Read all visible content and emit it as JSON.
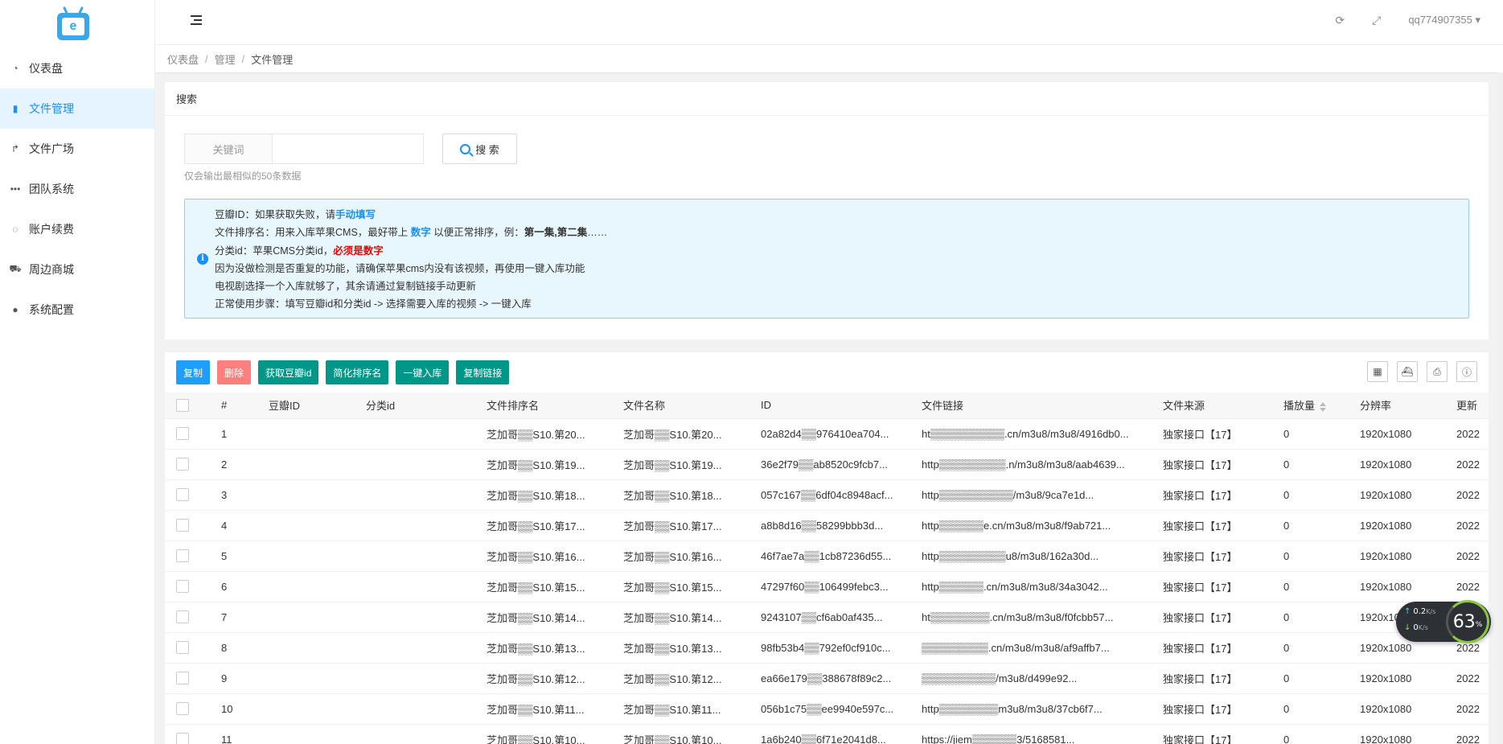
{
  "sidebar": {
    "logo_letter": "e",
    "items": [
      {
        "label": "仪表盘",
        "icon": "dashboard-icon",
        "glyph": "◔",
        "active": false
      },
      {
        "label": "文件管理",
        "icon": "file-icon",
        "glyph": "▮",
        "active": true
      },
      {
        "label": "文件广场",
        "icon": "share-icon",
        "glyph": "↱",
        "active": false
      },
      {
        "label": "团队系统",
        "icon": "more-icon",
        "glyph": "•••",
        "active": false
      },
      {
        "label": "账户续费",
        "icon": "circle-notch-icon",
        "glyph": "◌",
        "active": false
      },
      {
        "label": "周边商城",
        "icon": "cart-icon",
        "glyph": "⛟",
        "active": false
      },
      {
        "label": "系统配置",
        "icon": "user-icon",
        "glyph": "●",
        "active": false
      }
    ]
  },
  "header": {
    "username": "qq774907355",
    "caret": "▾",
    "refresh_glyph": "⟳",
    "fullscreen_glyph": "⤢"
  },
  "breadcrumb": {
    "items": [
      "仪表盘",
      "管理",
      "文件管理"
    ],
    "sep": "/"
  },
  "search": {
    "title": "搜索",
    "keyword_label": "关键词",
    "keyword_value": "",
    "button_label": "搜 索",
    "hint": "仅会输出最相似的50条数据"
  },
  "info": {
    "l1a": "豆瓣ID：如果获取失败，请",
    "l1b": "手动填写",
    "l2a": "文件排序名：用来入库苹果CMS，最好带上",
    "l2b": "数字",
    "l2c": "以便正常排序，例：",
    "l2d": "第一集,第二集",
    "l2e": "……",
    "l3a": "分类id：苹果CMS分类id，",
    "l3b": "必须是数字",
    "l4": "因为没做检测是否重复的功能，请确保苹果cms内没有该视频，再使用一键入库功能",
    "l5": "电视剧选择一个入库就够了，其余请通过复制链接手动更新",
    "l6": "正常使用步骤：填写豆瓣id和分类id -> 选择需要入库的视频 -> 一键入库"
  },
  "toolbar": {
    "copy": "复制",
    "delete": "删除",
    "fetch_douban": "获取豆瓣id",
    "simplify_sort": "简化排序名",
    "one_click_import": "一键入库",
    "copy_link": "复制链接"
  },
  "table": {
    "headers": [
      "#",
      "豆瓣ID",
      "分类id",
      "文件排序名",
      "文件名称",
      "ID",
      "文件链接",
      "文件来源",
      "播放量",
      "分辨率",
      "更新"
    ],
    "rows": [
      {
        "n": "1",
        "sort_name": "芝加哥▒▒S10.第20...",
        "file_name": "芝加哥▒▒S10.第20...",
        "id": "02a82d4▒▒976410ea704...",
        "link": "ht▒▒▒▒▒▒▒▒▒▒.cn/m3u8/m3u8/4916db0...",
        "source": "独家接口【17】",
        "plays": "0",
        "res": "1920x1080",
        "date": "2022"
      },
      {
        "n": "2",
        "sort_name": "芝加哥▒▒S10.第19...",
        "file_name": "芝加哥▒▒S10.第19...",
        "id": "36e2f79▒▒ab8520c9fcb7...",
        "link": "http▒▒▒▒▒▒▒▒▒.n/m3u8/m3u8/aab4639...",
        "source": "独家接口【17】",
        "plays": "0",
        "res": "1920x1080",
        "date": "2022"
      },
      {
        "n": "3",
        "sort_name": "芝加哥▒▒S10.第18...",
        "file_name": "芝加哥▒▒S10.第18...",
        "id": "057c167▒▒6df04c8948acf...",
        "link": "http▒▒▒▒▒▒▒▒▒▒/m3u8/9ca7e1d...",
        "source": "独家接口【17】",
        "plays": "0",
        "res": "1920x1080",
        "date": "2022"
      },
      {
        "n": "4",
        "sort_name": "芝加哥▒▒S10.第17...",
        "file_name": "芝加哥▒▒S10.第17...",
        "id": "a8b8d16▒▒58299bbb3d...",
        "link": "http▒▒▒▒▒▒e.cn/m3u8/m3u8/f9ab721...",
        "source": "独家接口【17】",
        "plays": "0",
        "res": "1920x1080",
        "date": "2022"
      },
      {
        "n": "5",
        "sort_name": "芝加哥▒▒S10.第16...",
        "file_name": "芝加哥▒▒S10.第16...",
        "id": "46f7ae7a▒▒1cb87236d55...",
        "link": "http▒▒▒▒▒▒▒▒▒u8/m3u8/162a30d...",
        "source": "独家接口【17】",
        "plays": "0",
        "res": "1920x1080",
        "date": "2022"
      },
      {
        "n": "6",
        "sort_name": "芝加哥▒▒S10.第15...",
        "file_name": "芝加哥▒▒S10.第15...",
        "id": "47297f60▒▒106499febc3...",
        "link": "http▒▒▒▒▒▒.cn/m3u8/m3u8/34a3042...",
        "source": "独家接口【17】",
        "plays": "0",
        "res": "1920x1080",
        "date": "2022"
      },
      {
        "n": "7",
        "sort_name": "芝加哥▒▒S10.第14...",
        "file_name": "芝加哥▒▒S10.第14...",
        "id": "9243107▒▒cf6ab0af435...",
        "link": "ht▒▒▒▒▒▒▒▒.cn/m3u8/m3u8/f0fcbb57...",
        "source": "独家接口【17】",
        "plays": "0",
        "res": "1920x1080",
        "date": "2022"
      },
      {
        "n": "8",
        "sort_name": "芝加哥▒▒S10.第13...",
        "file_name": "芝加哥▒▒S10.第13...",
        "id": "98fb53b4▒▒792ef0cf910c...",
        "link": "▒▒▒▒▒▒▒▒▒.cn/m3u8/m3u8/af9affb7...",
        "source": "独家接口【17】",
        "plays": "0",
        "res": "1920x1080",
        "date": "2022"
      },
      {
        "n": "9",
        "sort_name": "芝加哥▒▒S10.第12...",
        "file_name": "芝加哥▒▒S10.第12...",
        "id": "ea66e179▒▒388678f89c2...",
        "link": "▒▒▒▒▒▒▒▒▒▒/m3u8/d499e92...",
        "source": "独家接口【17】",
        "plays": "0",
        "res": "1920x1080",
        "date": "2022"
      },
      {
        "n": "10",
        "sort_name": "芝加哥▒▒S10.第11...",
        "file_name": "芝加哥▒▒S10.第11...",
        "id": "056b1c75▒▒ee9940e597c...",
        "link": "http▒▒▒▒▒▒▒▒m3u8/m3u8/37cb6f7...",
        "source": "独家接口【17】",
        "plays": "0",
        "res": "1920x1080",
        "date": "2022"
      },
      {
        "n": "11",
        "sort_name": "芝加哥▒▒S10.第10...",
        "file_name": "芝加哥▒▒S10.第10...",
        "id": "1a6b240▒▒6f71e2041d8...",
        "link": "https://jiem▒▒▒▒▒▒3/5168581...",
        "source": "独家接口【17】",
        "plays": "0",
        "res": "1920x1080",
        "date": "2022"
      }
    ]
  },
  "net_widget": {
    "up_rate": "0.2",
    "down_rate": "0",
    "unit": "K/s",
    "percent": "63",
    "percent_sign": "%"
  },
  "colors": {
    "accent": "#1890ff",
    "btn_blue": "#1e9fff",
    "btn_red": "#ff7e7e",
    "btn_green": "#009688",
    "info_bg": "#e8f6fd"
  }
}
